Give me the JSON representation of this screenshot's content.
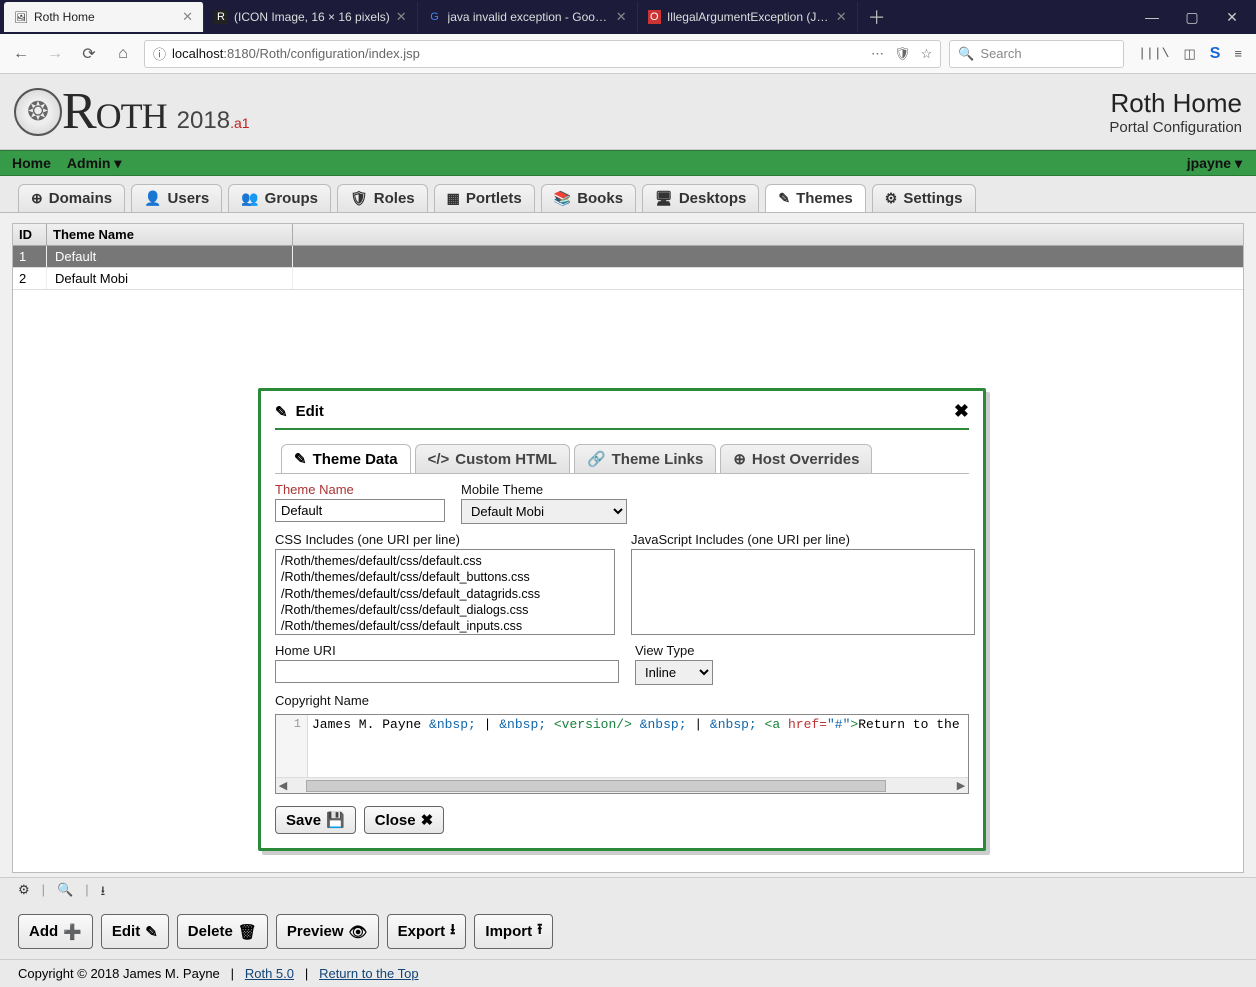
{
  "browser": {
    "tabs": [
      {
        "title": "Roth Home",
        "active": true
      },
      {
        "title": "(ICON Image, 16 × 16 pixels)",
        "active": false
      },
      {
        "title": "java invalid exception - Google",
        "active": false
      },
      {
        "title": "IllegalArgumentException (Jav...",
        "active": false
      }
    ],
    "url_prefix": "localhost",
    "url_rest": ":8180/Roth/configuration/index.jsp",
    "search_placeholder": "Search"
  },
  "header": {
    "brand": "Roth",
    "year": "2018",
    "suffix": ".a1",
    "title": "Roth Home",
    "subtitle": "Portal Configuration"
  },
  "menubar": {
    "left": [
      "Home",
      "Admin ▾"
    ],
    "user": "jpayne ▾"
  },
  "tabs": [
    {
      "icon": "⊕",
      "label": "Domains"
    },
    {
      "icon": "👤",
      "label": "Users"
    },
    {
      "icon": "👥",
      "label": "Groups"
    },
    {
      "icon": "🛡",
      "label": "Roles"
    },
    {
      "icon": "▦",
      "label": "Portlets"
    },
    {
      "icon": "📚",
      "label": "Books"
    },
    {
      "icon": "🖥",
      "label": "Desktops"
    },
    {
      "icon": "✎",
      "label": "Themes",
      "active": true
    },
    {
      "icon": "⚙",
      "label": "Settings"
    }
  ],
  "grid": {
    "headers": {
      "id": "ID",
      "name": "Theme Name"
    },
    "rows": [
      {
        "id": "1",
        "name": "Default",
        "selected": true
      },
      {
        "id": "2",
        "name": "Default Mobi",
        "selected": false
      }
    ]
  },
  "dialog": {
    "title": "Edit",
    "tabs": [
      "Theme Data",
      "Custom HTML",
      "Theme Links",
      "Host Overrides"
    ],
    "tab_icons": [
      "✎",
      "</>",
      "🔗",
      "⊕"
    ],
    "labels": {
      "theme_name": "Theme Name",
      "mobile_theme": "Mobile Theme",
      "css_includes": "CSS Includes (one URI per line)",
      "js_includes": "JavaScript Includes (one URI per line)",
      "home_uri": "Home URI",
      "view_type": "View Type",
      "copyright": "Copyright Name"
    },
    "values": {
      "theme_name": "Default",
      "mobile_theme": "Default Mobi",
      "css_includes": "/Roth/themes/default/css/default.css\n/Roth/themes/default/css/default_buttons.css\n/Roth/themes/default/css/default_datagrids.css\n/Roth/themes/default/css/default_dialogs.css\n/Roth/themes/default/css/default_inputs.css",
      "js_includes": "",
      "home_uri": "",
      "view_type": "Inline",
      "copyright_code_plain": "James M. Payne &nbsp; | &nbsp; <version/> &nbsp; | &nbsp; <a href=\"#\">Return to the"
    },
    "buttons": {
      "save": "Save",
      "close": "Close"
    }
  },
  "actions": {
    "add": "Add",
    "edit": "Edit",
    "delete": "Delete",
    "preview": "Preview",
    "export": "Export",
    "import": "Import"
  },
  "footer": {
    "copyright": "Copyright © 2018 James M. Payne",
    "link1": "Roth 5.0",
    "link2": "Return to the Top"
  }
}
